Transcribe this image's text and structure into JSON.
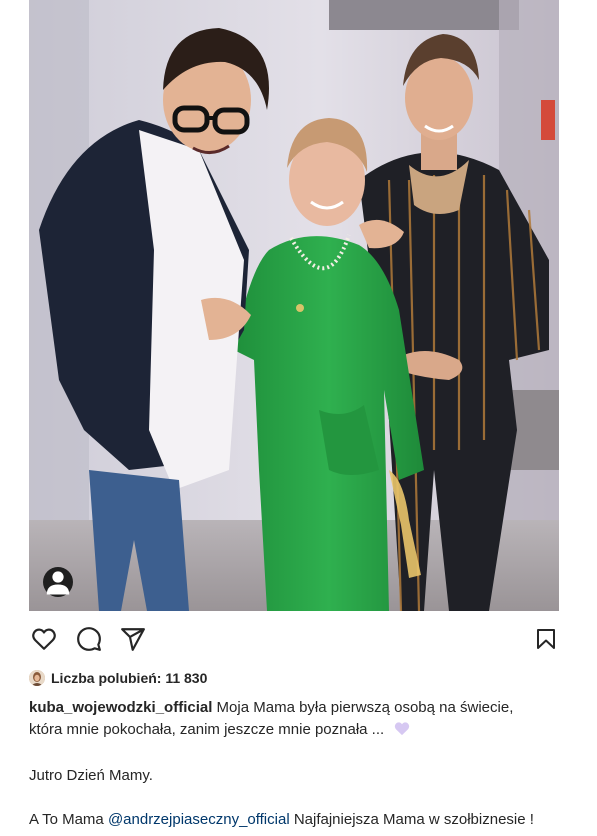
{
  "post": {
    "image_alt": "",
    "tag_button_icon": "person-icon"
  },
  "actions": {
    "like_icon": "heart-outline-icon",
    "comment_icon": "comment-icon",
    "share_icon": "paper-plane-icon",
    "save_icon": "bookmark-icon"
  },
  "likes": {
    "text": "Liczba polubień: 11 830"
  },
  "caption": {
    "username": "kuba_wojewodzki_official",
    "line1_text": " Moja Mama była pierwszą osobą na świecie,",
    "line2_text": "która mnie pokochała, zanim jeszcze mnie poznała ... ",
    "emoji_icon": "light-purple-heart-icon",
    "line3_text": "Jutro Dzień Mamy.",
    "line4_prefix": "A To Mama ",
    "mention": "@andrzejpiaseczny_official",
    "line4_suffix": " Najfajniejsza Mama w szołbiznesie !"
  },
  "colors": {
    "text": "#262626",
    "mention": "#00376b",
    "dress": "#2aa54a",
    "heart_emoji": "#d6c8f2"
  }
}
